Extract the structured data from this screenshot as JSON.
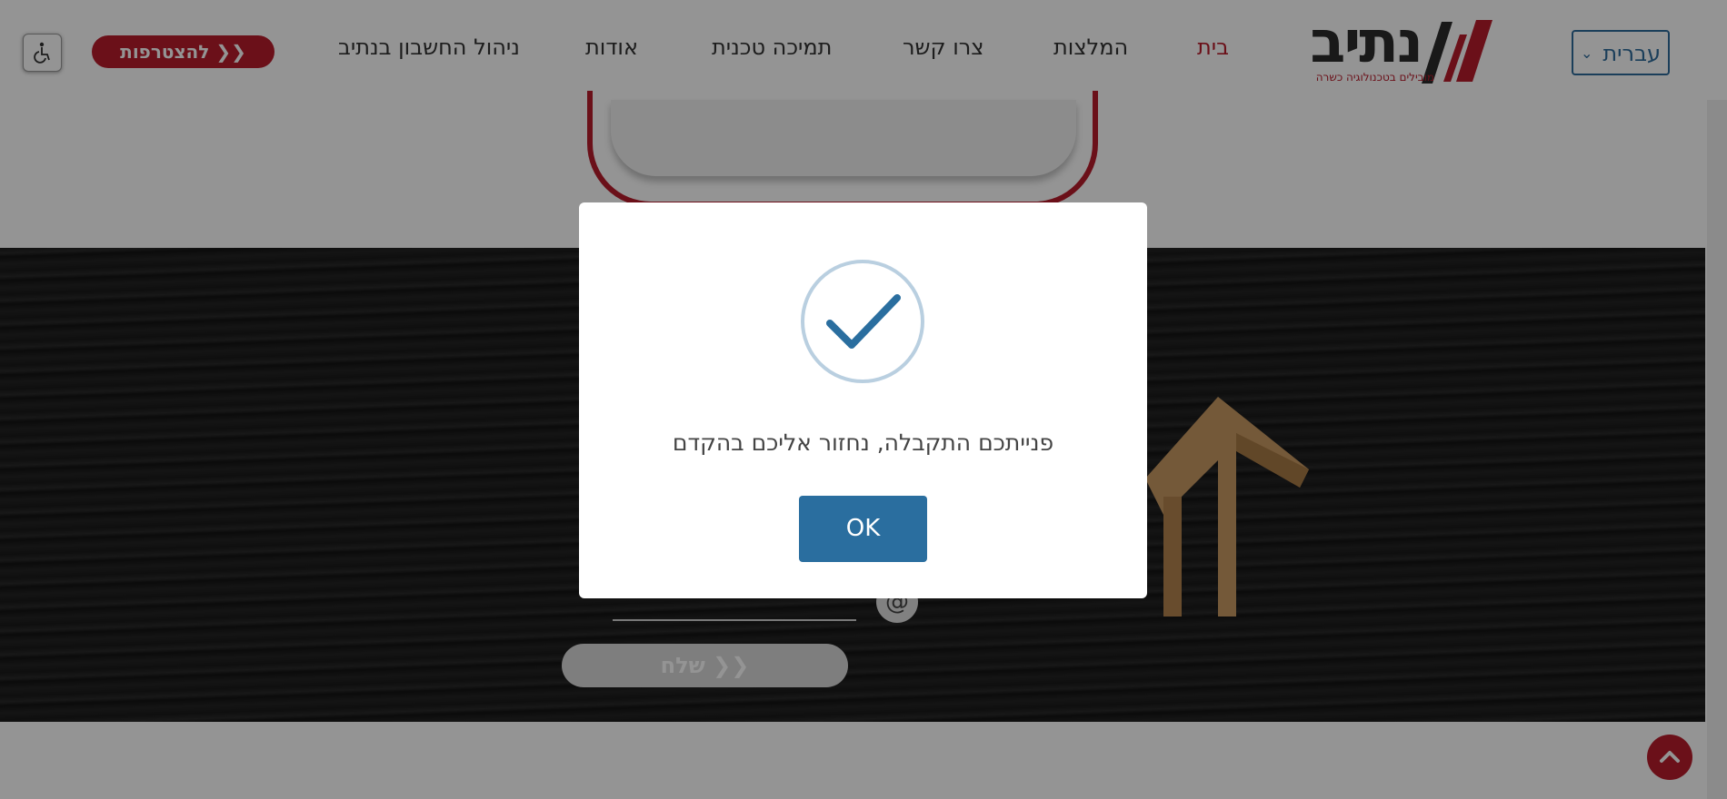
{
  "header": {
    "language": "עברית",
    "logo": {
      "word": "נתיב",
      "tagline": "מובילים בטכנולוגיה כשרה"
    },
    "nav": [
      {
        "label": "בית",
        "active": true
      },
      {
        "label": "המלצות"
      },
      {
        "label": "צרו קשר"
      },
      {
        "label": "תמיכה טכנית"
      },
      {
        "label": "אודות"
      },
      {
        "label": "ניהול החשבון בנתיב"
      }
    ],
    "join_label": "להצטרפות ❯❯",
    "accessibility_icon": "wheelchair-icon"
  },
  "form": {
    "at_symbol": "@",
    "send_label": "שלח ❯❯"
  },
  "dialog": {
    "message": "פנייתכם התקבלה, נחזור אליכם בהקדם",
    "ok_label": "OK",
    "icon": "success-check-icon"
  },
  "scroll_top_icon": "chevron-up-icon",
  "colors": {
    "brand_red": "#b81c2c",
    "link_blue": "#2e6b9b",
    "ok_button": "#2a6e9f",
    "check_ring": "#b9cfe0"
  }
}
